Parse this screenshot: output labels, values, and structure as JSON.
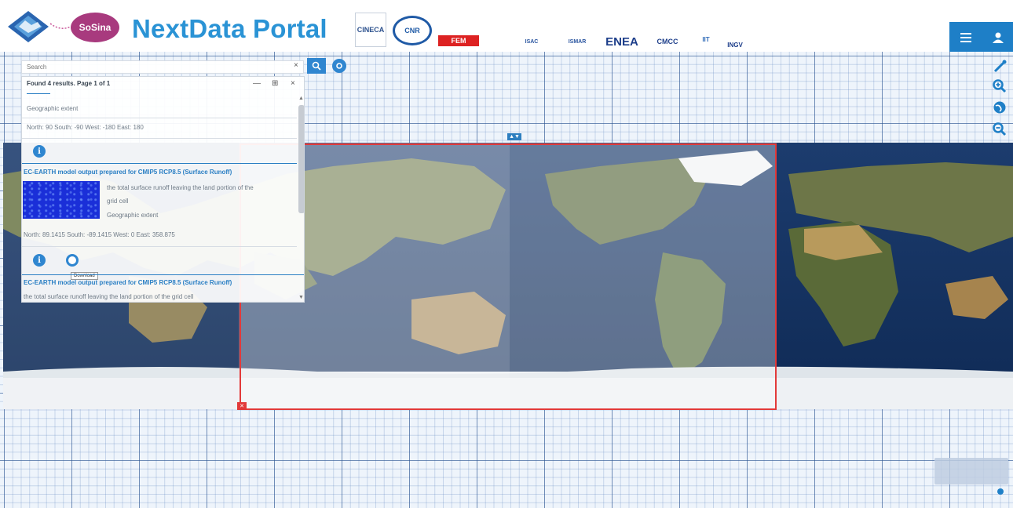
{
  "header": {
    "badge_label": "SoSina",
    "portal_title": "NextData Portal",
    "partners": [
      {
        "name": "CINECA",
        "color": "#2a4f8c"
      },
      {
        "name": "CNR",
        "color": "#1f5aa6"
      },
      {
        "name": "FEM",
        "color": "#d22"
      },
      {
        "name": "ISAC",
        "color": "#2b56a0"
      },
      {
        "name": "ISMAR",
        "color": "#2b56a0"
      },
      {
        "name": "ENEA",
        "color": "#1d3e8a"
      },
      {
        "name": "CMCC",
        "color": "#1d3e8a"
      },
      {
        "name": "IIT",
        "color": "#2f6ab8"
      },
      {
        "name": "INGV",
        "color": "#1d3e8a"
      }
    ],
    "menu_icon": "menu-icon",
    "user_icon": "user-icon"
  },
  "search": {
    "placeholder": "Search",
    "clear_glyph": "×"
  },
  "results_panel": {
    "summary": "Found 4 results. Page 1 of 1",
    "controls": {
      "minimize": "—",
      "maximize": "⊞",
      "close": "×"
    },
    "extent_label": "Geographic extent",
    "extent_1": "North: 90 South: -90 West: -180 East: 180",
    "results": [
      {
        "title": "EC-EARTH model output prepared for CMIP5 RCP8.5 (Surface Runoff)",
        "description_line1": "the total surface runoff leaving the land portion of the",
        "description_line2": "grid cell",
        "extent_label": "Geographic extent",
        "extent": "North: 89.1415 South: -89.1415 West: 0 East: 358.875"
      },
      {
        "title": "EC-EARTH model output prepared for CMIP5 RCP8.5 (Surface Runoff)",
        "description": "the total surface runoff leaving the land portion of the grid cell"
      }
    ],
    "tooltip": "Download"
  },
  "map": {
    "bbox_color": "#e23a3a",
    "tools": [
      "measure-icon",
      "zoom-in-icon",
      "globe-icon",
      "zoom-out-icon"
    ]
  }
}
